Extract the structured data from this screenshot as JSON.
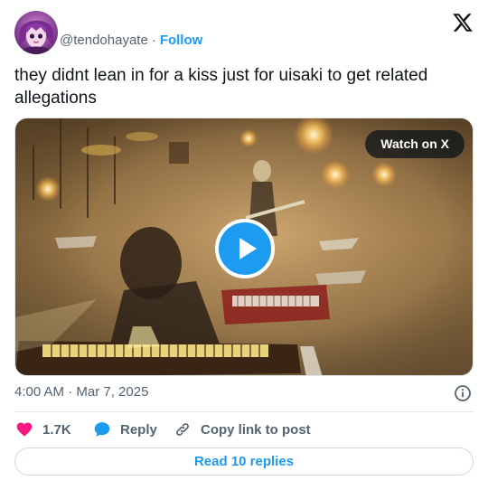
{
  "author": {
    "display_name": "",
    "handle": "@tendohayate",
    "separator": "·",
    "follow_label": "Follow"
  },
  "tweet": {
    "text": "they didnt lean in for a kiss just for uisaki to get related allegations",
    "timestamp": "4:00 AM · Mar 7, 2025"
  },
  "media": {
    "watch_label": "Watch on X",
    "play_icon": "play-icon"
  },
  "actions": {
    "like_count": "1.7K",
    "reply_label": "Reply",
    "copy_link_label": "Copy link to post"
  },
  "replies_button": "Read 10 replies",
  "colors": {
    "accent": "#1d9bf0",
    "like": "#f91880",
    "text_primary": "#0f1419",
    "text_secondary": "#536471"
  }
}
